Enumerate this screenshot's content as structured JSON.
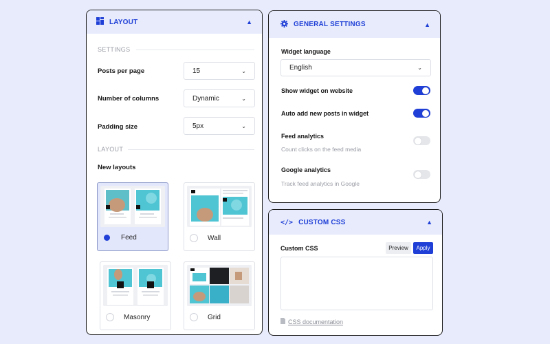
{
  "layout_panel": {
    "title": "LAYOUT",
    "settings_section": "SETTINGS",
    "layout_section": "LAYOUT",
    "rows": [
      {
        "label": "Posts per page",
        "value": "15"
      },
      {
        "label": "Number of columns",
        "value": "Dynamic"
      },
      {
        "label": "Padding size",
        "value": "5px"
      }
    ],
    "new_layouts_label": "New layouts",
    "options": [
      {
        "label": "Feed",
        "selected": true
      },
      {
        "label": "Wall",
        "selected": false
      },
      {
        "label": "Masonry",
        "selected": false
      },
      {
        "label": "Grid",
        "selected": false
      }
    ]
  },
  "general_panel": {
    "title": "GENERAL SETTINGS",
    "widget_language_label": "Widget language",
    "widget_language_value": "English",
    "settings": [
      {
        "label": "Show widget on website",
        "subtitle": "",
        "enabled": true
      },
      {
        "label": "Auto add new posts in widget",
        "subtitle": "",
        "enabled": true
      },
      {
        "label": "Feed analytics",
        "subtitle": "Count clicks on the feed media",
        "enabled": false
      },
      {
        "label": "Google analytics",
        "subtitle": "Track feed analytics in Google",
        "enabled": false
      }
    ]
  },
  "css_panel": {
    "title": "CUSTOM CSS",
    "field_label": "Custom CSS",
    "preview_label": "Preview",
    "apply_label": "Apply",
    "textarea_value": "",
    "doc_link": "CSS documentation"
  },
  "colors": {
    "accent": "#1f3fd6",
    "header_bg": "#e7ebfc",
    "page_bg": "#e8ebfb"
  }
}
